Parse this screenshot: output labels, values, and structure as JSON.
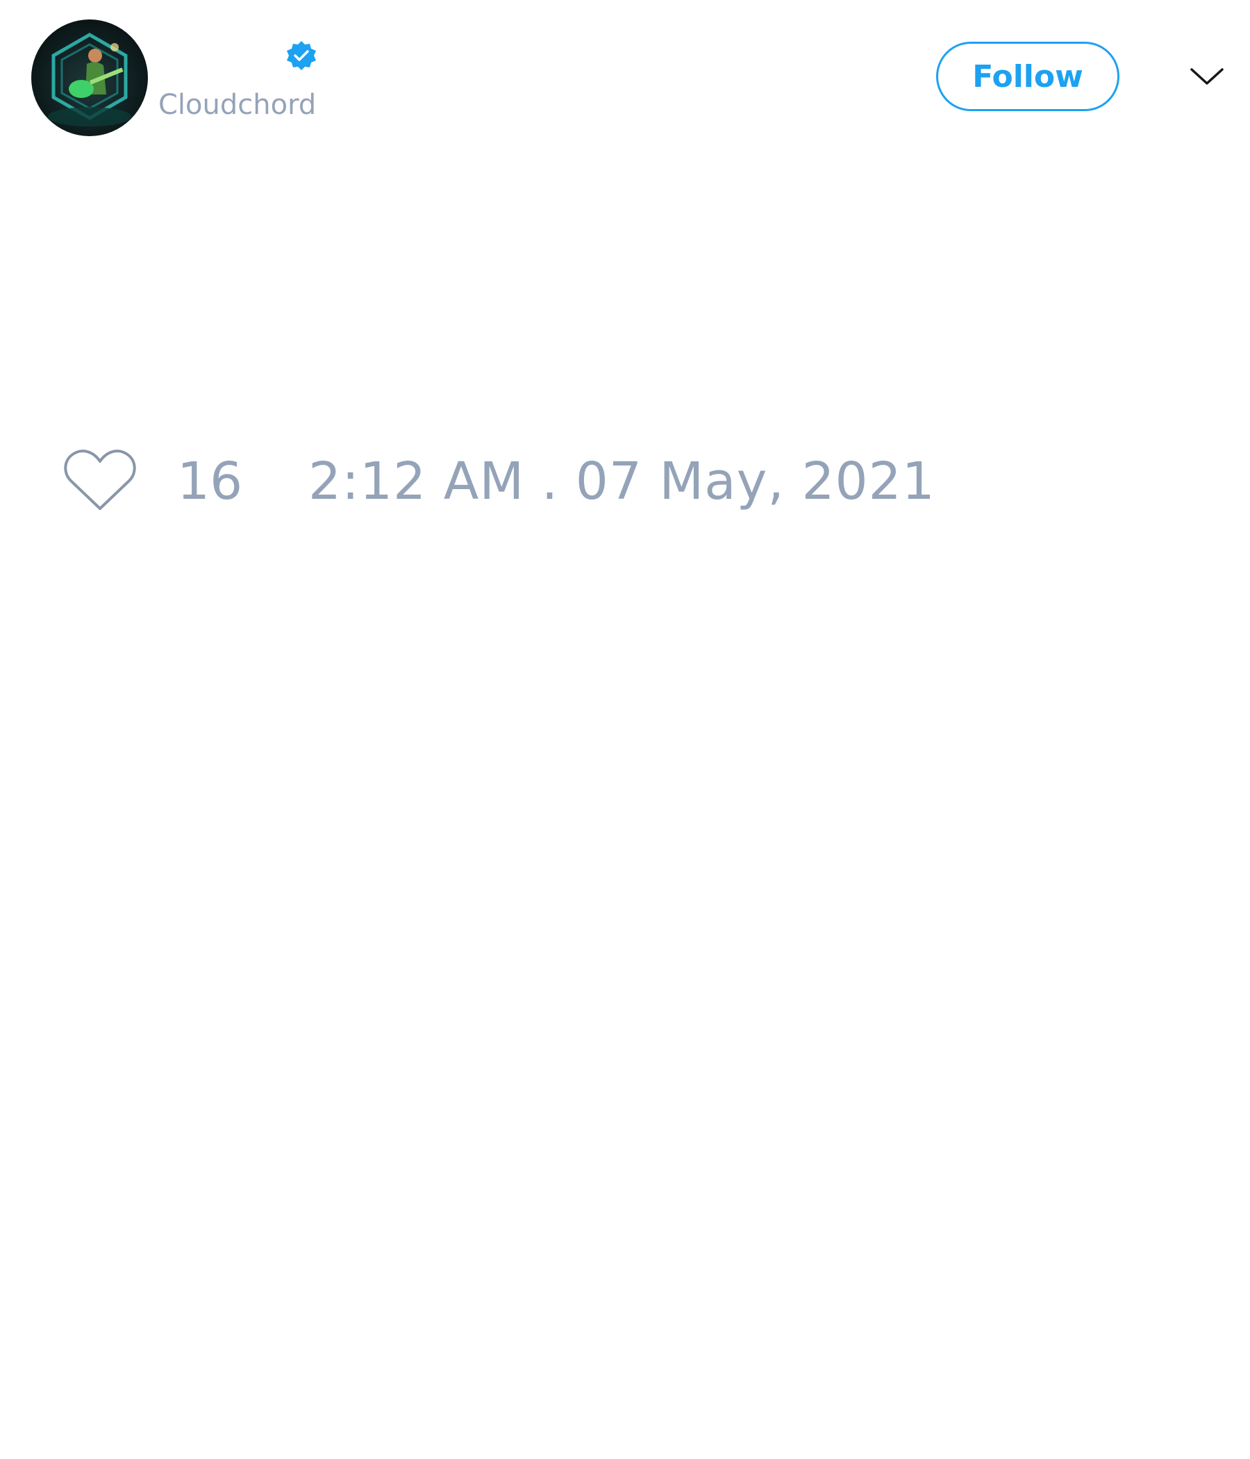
{
  "tweet": {
    "author": {
      "display_name": "",
      "handle": "Cloudchord",
      "verified": true,
      "avatar_icon": "guitarist-avatar"
    },
    "follow_button_label": "Follow",
    "more_menu_icon": "chevron-down-icon",
    "like_icon": "heart-icon",
    "like_count": "16",
    "timestamp": "2:12 AM . 07 May, 2021"
  },
  "colors": {
    "accent": "#1da1f2",
    "muted_text": "#94a3b8",
    "background": "#ffffff"
  }
}
